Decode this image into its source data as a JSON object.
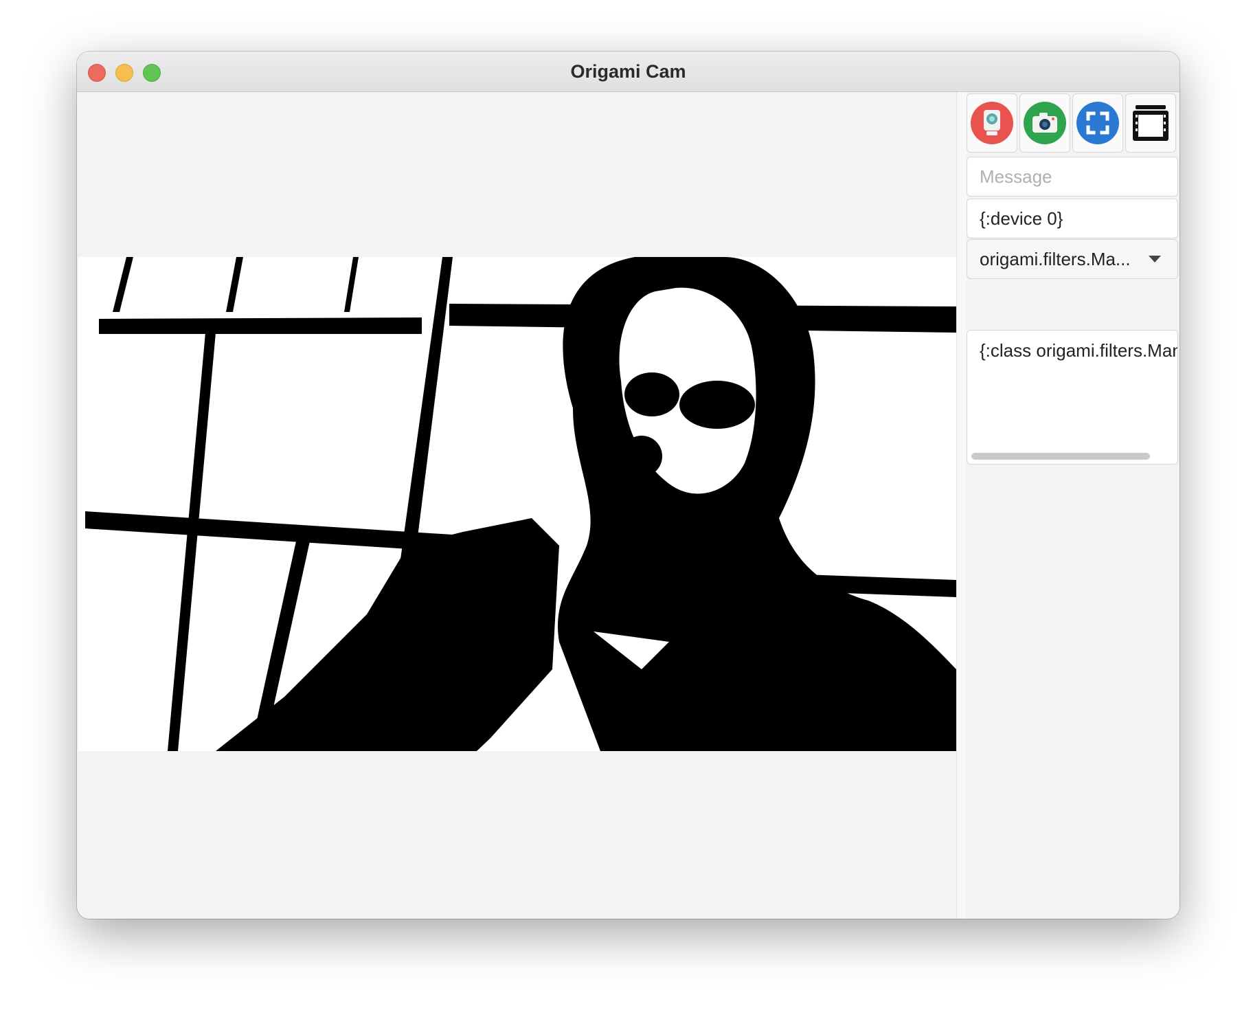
{
  "window": {
    "title": "Origami Cam"
  },
  "toolbar": {
    "buttons": [
      {
        "name": "webcam-icon",
        "color": "#e8534f"
      },
      {
        "name": "camera-icon",
        "color": "#2ea44f"
      },
      {
        "name": "fullscreen-icon",
        "color": "#2a78d2"
      },
      {
        "name": "film-icon",
        "color": "#111111"
      }
    ]
  },
  "sidebar": {
    "message_placeholder": "Message",
    "device_value": "{:device 0}",
    "filter_selected": "origami.filters.Ma...",
    "filter_config": "{:class origami.filters.Manga"
  }
}
